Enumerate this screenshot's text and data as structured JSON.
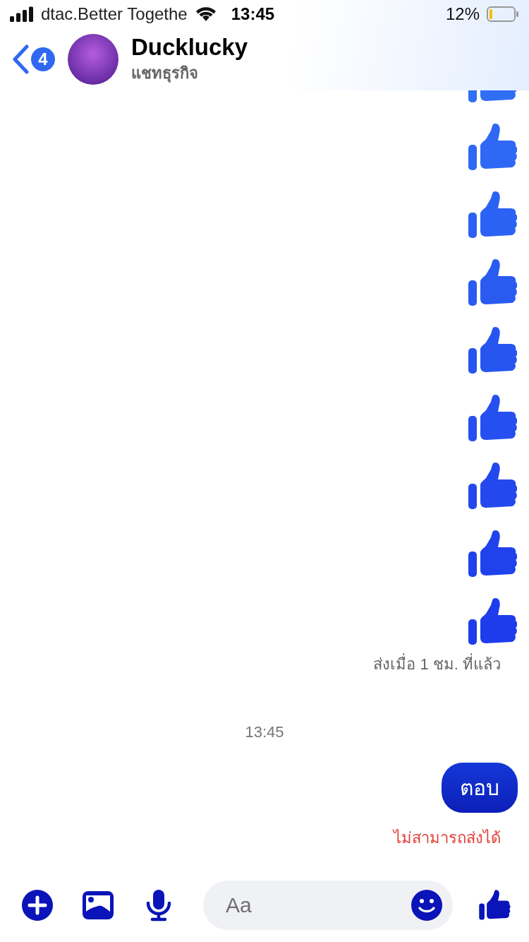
{
  "status_bar": {
    "carrier": "dtac.Better Togethe",
    "time": "13:45",
    "battery": "12%"
  },
  "header": {
    "back_count": "4",
    "name": "Ducklucky",
    "subtitle": "แชทธุรกิจ"
  },
  "messages": [
    {
      "kind": "like"
    },
    {
      "kind": "like"
    },
    {
      "kind": "like"
    },
    {
      "kind": "like"
    },
    {
      "kind": "like"
    },
    {
      "kind": "like"
    },
    {
      "kind": "like"
    },
    {
      "kind": "like"
    },
    {
      "kind": "like"
    },
    {
      "kind": "status",
      "text": "ส่งเมื่อ 1 ชม. ที่แล้ว"
    },
    {
      "kind": "time",
      "text": "13:45"
    },
    {
      "kind": "text",
      "text": "ตอบ"
    },
    {
      "kind": "error",
      "text": "ไม่สามารถส่งได้"
    }
  ],
  "composer": {
    "placeholder": "Aa"
  }
}
